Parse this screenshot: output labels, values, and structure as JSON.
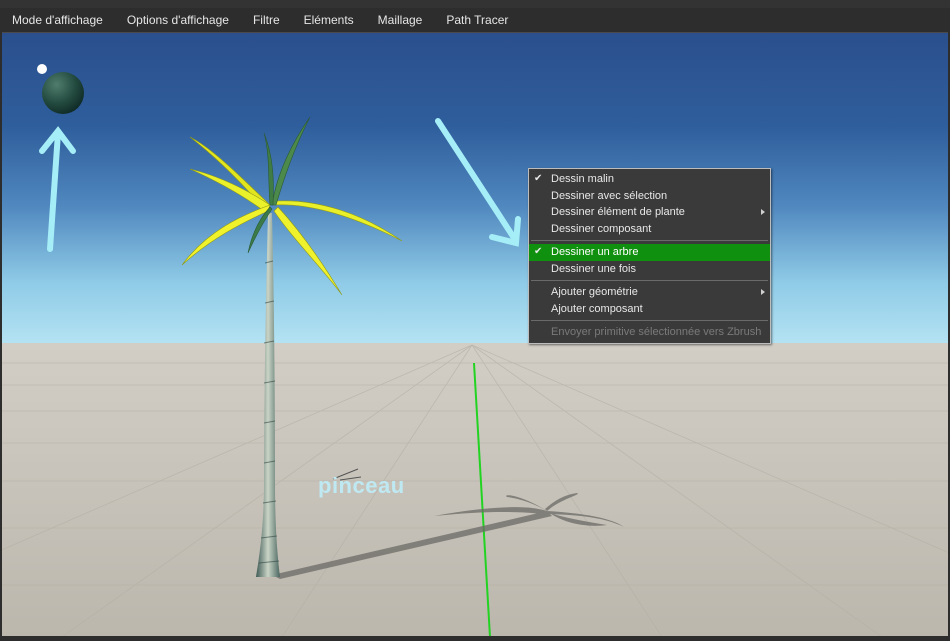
{
  "menubar": {
    "items": [
      {
        "label": "Mode d'affichage"
      },
      {
        "label": "Options d'affichage"
      },
      {
        "label": "Filtre"
      },
      {
        "label": "Eléments"
      },
      {
        "label": "Maillage"
      },
      {
        "label": "Path Tracer"
      }
    ]
  },
  "viewport": {
    "annotation_label": "pinceau",
    "annotation_color": "#bfe9f2",
    "sky_top_color": "#2a4f8e",
    "horizon_color": "#a8ddf0",
    "ground_color": "#c5c1b7",
    "axis_line_color": "#22d322"
  },
  "context_menu": {
    "groups": [
      [
        {
          "label": "Dessin malin",
          "checked": true
        },
        {
          "label": "Dessiner avec sélection"
        },
        {
          "label": "Dessiner élément de plante",
          "submenu": true
        },
        {
          "label": "Dessiner composant"
        }
      ],
      [
        {
          "label": "Dessiner un arbre",
          "checked": true,
          "active": true
        },
        {
          "label": "Dessiner une fois"
        }
      ],
      [
        {
          "label": "Ajouter géométrie",
          "submenu": true
        },
        {
          "label": "Ajouter composant"
        }
      ],
      [
        {
          "label": "Envoyer primitive sélectionnée vers Zbrush",
          "disabled": true
        }
      ]
    ],
    "active_color": "#10900f"
  }
}
